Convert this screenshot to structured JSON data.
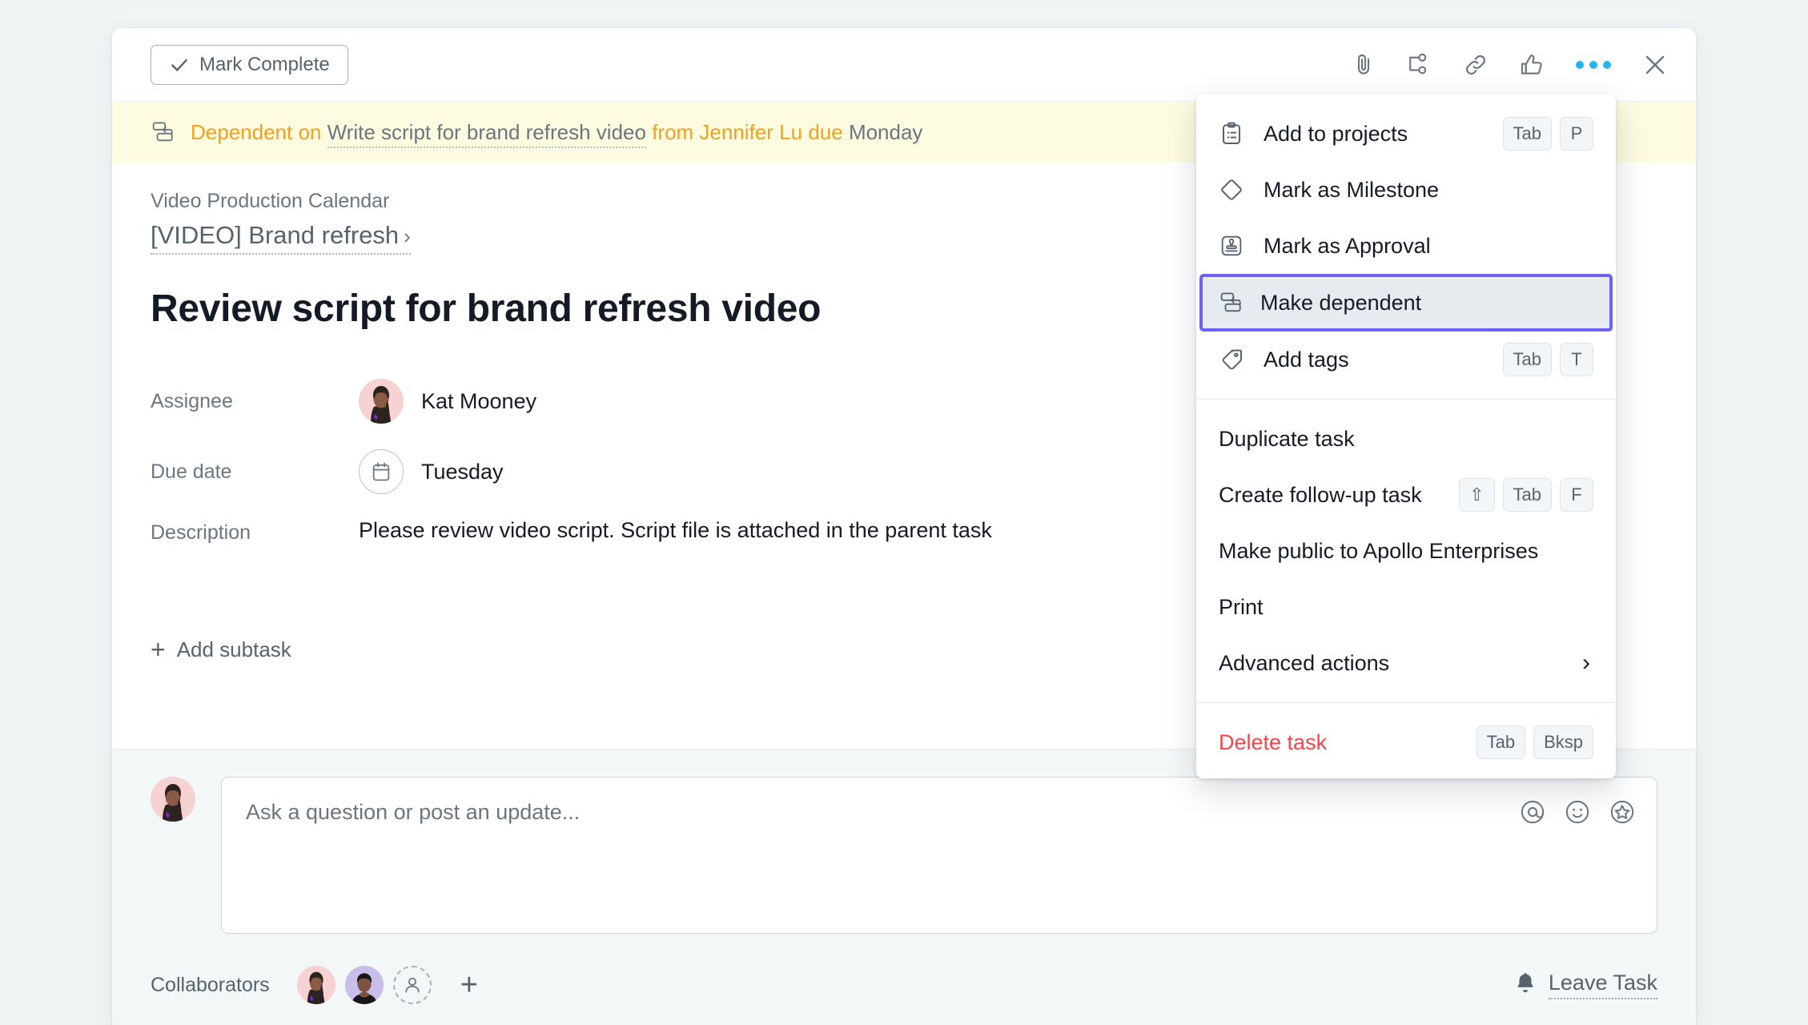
{
  "header": {
    "mark_complete_label": "Mark Complete",
    "icons": [
      {
        "name": "attachment-icon",
        "label": "Attach file"
      },
      {
        "name": "subtask-icon",
        "label": "Add subtask"
      },
      {
        "name": "link-icon",
        "label": "Copy task link"
      },
      {
        "name": "like-icon",
        "label": "Like task"
      },
      {
        "name": "more-options-icon",
        "label": "More actions"
      },
      {
        "name": "close-icon",
        "label": "Close"
      }
    ]
  },
  "dependency_banner": {
    "prefix": "Dependent on",
    "task_link": "Write script for brand refresh video",
    "from_label": "from",
    "person": "Jennifer Lu",
    "due_label": "due",
    "due_value": "Monday"
  },
  "task": {
    "project_name": "Video Production Calendar",
    "parent_task": "[VIDEO] Brand refresh",
    "parent_chevron": "›",
    "title": "Review script for brand refresh video",
    "fields": [
      {
        "label": "Assignee",
        "value": "Kat Mooney"
      },
      {
        "label": "Due date",
        "value": "Tuesday"
      },
      {
        "label": "Description",
        "value": "Please review video script. Script file is attached in the parent task"
      }
    ],
    "add_subtask_label": "Add subtask",
    "add_subtask_plus": "+"
  },
  "comment": {
    "placeholder": "Ask a question or post an update...",
    "icons": [
      {
        "name": "mention-icon"
      },
      {
        "name": "emoji-icon"
      },
      {
        "name": "sticker-icon"
      }
    ]
  },
  "footer": {
    "collaborators_label": "Collaborators",
    "add_collaborator_plus": "+",
    "leave_task_label": "Leave Task"
  },
  "menu": {
    "items": [
      {
        "label": "Add to projects",
        "icon": "clipboard-list-icon",
        "keys": [
          "Tab",
          "P"
        ],
        "selected": false,
        "danger": false
      },
      {
        "label": "Mark as Milestone",
        "icon": "diamond-icon",
        "keys": [],
        "selected": false,
        "danger": false
      },
      {
        "label": "Mark as Approval",
        "icon": "stamp-icon",
        "keys": [],
        "selected": false,
        "danger": false
      },
      {
        "label": "Make dependent",
        "icon": "dependency-icon",
        "keys": [],
        "selected": true,
        "danger": false
      },
      {
        "label": "Add tags",
        "icon": "tag-icon",
        "keys": [
          "Tab",
          "T"
        ],
        "selected": false,
        "danger": false
      }
    ],
    "items2": [
      {
        "label": "Duplicate task",
        "keys": [],
        "arrow": false
      },
      {
        "label": "Create follow-up task",
        "keys": [
          "⇧",
          "Tab",
          "F"
        ],
        "arrow": false
      },
      {
        "label": "Make public to Apollo Enterprises",
        "keys": [],
        "arrow": false
      },
      {
        "label": "Print",
        "keys": [],
        "arrow": false
      },
      {
        "label": "Advanced actions",
        "keys": [],
        "arrow": true,
        "arrow_glyph": "›"
      }
    ],
    "delete": {
      "label": "Delete task",
      "keys": [
        "Tab",
        "Bksp"
      ]
    }
  },
  "colors": {
    "page_bg": "#f0f4f5",
    "banner_bg": "#fdfbe0",
    "banner_accent": "#f2a01d",
    "selected_border": "#6c63f5",
    "selected_bg": "#e7eaee",
    "danger": "#f4454e",
    "dots_blue": "#25b4f0"
  }
}
